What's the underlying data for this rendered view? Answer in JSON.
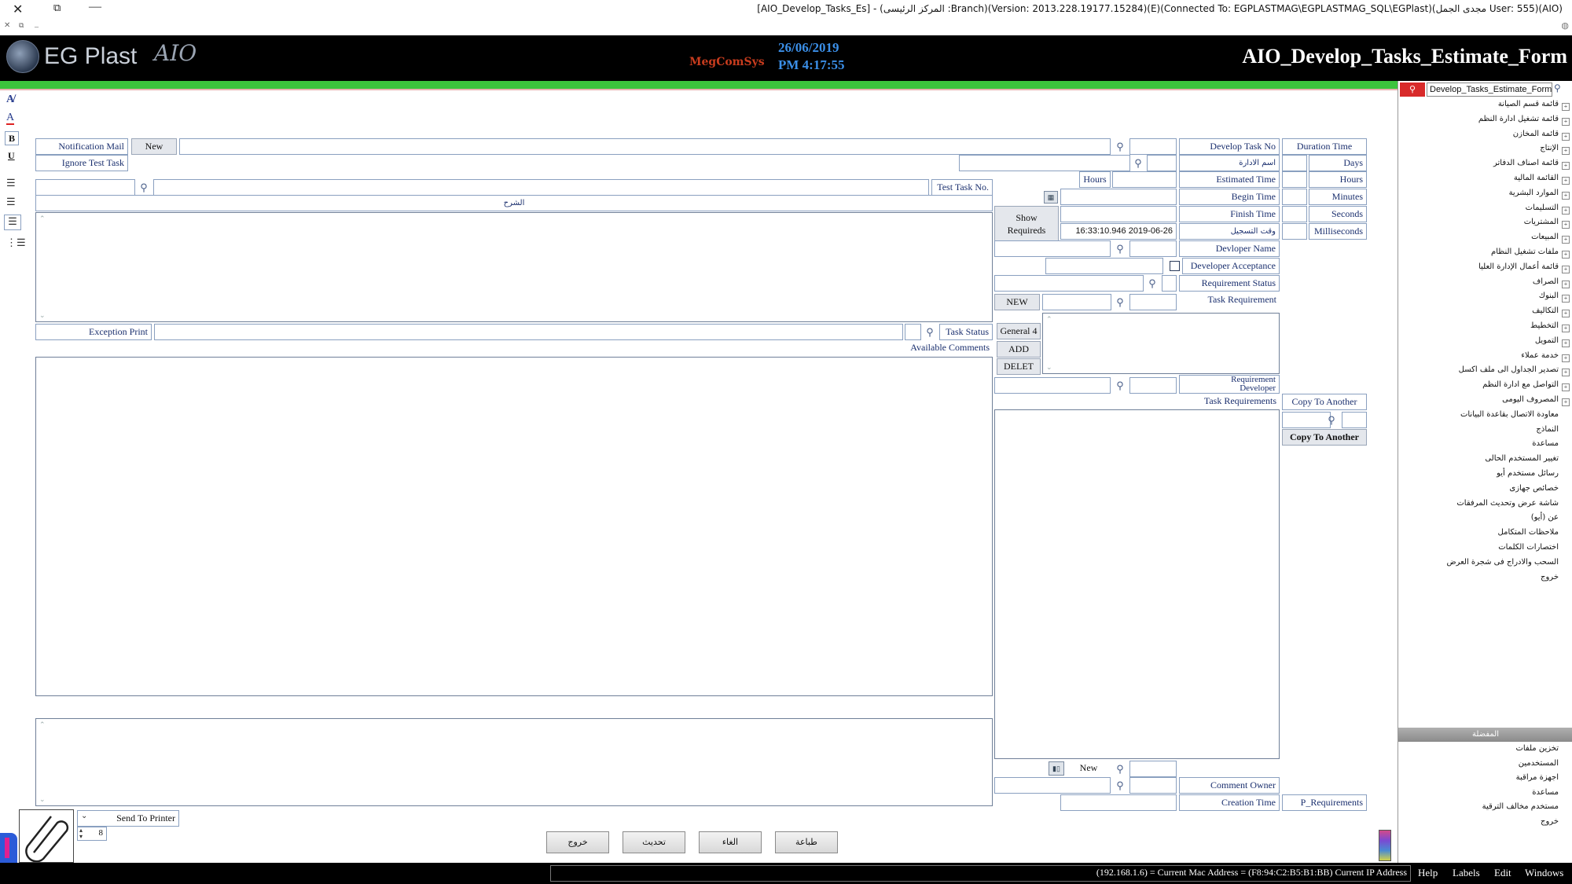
{
  "titlebar": {
    "title": "[AIO_Develop_Tasks_Es] - (المركز الرئيسى :Branch)(Version: 2013.228.19177.15284)(E)(Connected To: EGPLASTMAG\\EGPLASTMAG_SQL\\EGPlast)(مجدى الجمل User: 555)(AIO)"
  },
  "header": {
    "logo_text": "EG Plast",
    "logo_suffix": "AIO",
    "center_logo": "MegComSys",
    "date": "26/06/2019",
    "time": "PM 4:17:55",
    "form_title": "AIO_Develop_Tasks_Estimate_Form",
    "accent_green": "#3cc43c",
    "header_bg": "#000000",
    "date_color": "#3b8fe8"
  },
  "sidebar_search": {
    "value": "Develop_Tasks_Estimate_Form"
  },
  "tree": [
    "قائمة قسم الصيانة",
    "قائمة تشغيل ادارة النظم",
    "قائمة المخازن",
    "الإنتاج",
    "قائمة اصناف الدفاتر",
    "القائمة المالية",
    "الموارد البشرية",
    "التسليمات",
    "المشتريات",
    "المبيعات",
    "ملفات تشغيل النظام",
    "قائمة أعمال الإدارة العليا",
    "الصراف",
    "البنوك",
    "التكاليف",
    "التخطيط",
    "التمويل",
    "خدمة عملاء",
    "تصدير الجداول الى ملف اكسل",
    "التواصل مع ادارة النظم",
    "المصروف اليومى",
    "معاودة الاتصال بقاعدة البيانات",
    "النماذج",
    "مساعدة",
    "تغيير المستخدم الحالى",
    "رسائل مستخدم أيو",
    "خصائص جهازى",
    "شاشة عرض وتحديث المرفقات",
    "عن (أيو)",
    "ملاحظات المتكامل",
    "اختصارات الكلمات",
    "السحب والادراج فى شجرة العرض",
    "خروج"
  ],
  "favorites": {
    "header": "المفضلة",
    "items": [
      "تخزين ملفات",
      "المستخدمين",
      "اجهزة مراقبة",
      "مساعدة",
      "مستخدم مخالف الترقية",
      "خروج"
    ]
  },
  "form": {
    "notification_mail": "Notification Mail",
    "ignore_test_task": "Ignore Test Task",
    "new_btn": "New",
    "develop_task_no": "Develop Task No",
    "admin_name": "اسم الادارة",
    "test_task_no": "Test Task No.",
    "description": "الشرح",
    "hours_small": "Hours",
    "estimated_time": "Estimated Time",
    "begin_time": "Begin Time",
    "finish_time": "Finish Time",
    "register_time": "وقت التسجيل",
    "register_time_value": "16:33:10.946 2019-06-26",
    "show_requireds_1": "Show",
    "show_requireds_2": "Requireds",
    "devloper_name": "Devloper Name",
    "developer_acceptance": "Developer Acceptance",
    "requirement_status": "Requirement Status",
    "task_requirement": "Task Requirement",
    "new_upper": "NEW",
    "general": "General 4",
    "add": "ADD",
    "delet": "DELET",
    "requirement_developer_1": "Requirement",
    "requirement_developer_2": "Developer",
    "task_requirements": "Task Requirements",
    "exception_print": "Exception Print",
    "task_status": "Task Status",
    "available_comments": "Available Comments",
    "duration_time": "Duration Time",
    "days": "Days",
    "hours": "Hours",
    "minutes": "Minutes",
    "seconds": "Seconds",
    "milliseconds": "Milliseconds",
    "copy_to_another_label": "Copy To Another",
    "copy_to_another_btn": "Copy To Another",
    "comment_new": "New",
    "comment_owner": "Comment Owner",
    "creation_time": "Creation Time",
    "p_requirements": "P_Requirements",
    "send_to_printer": "Send To Printer",
    "copies": "8"
  },
  "actions": {
    "exit": "خروج",
    "update": "تحديث",
    "cancel": "الغاء",
    "print": "طباعة"
  },
  "statusbar": {
    "info": "(192.168.1.6) = Current Mac Address = (F8:94:C2:B5:B1:BB) Current IP Address",
    "menu": [
      "Help",
      "Labels",
      "Edit",
      "Windows"
    ]
  }
}
